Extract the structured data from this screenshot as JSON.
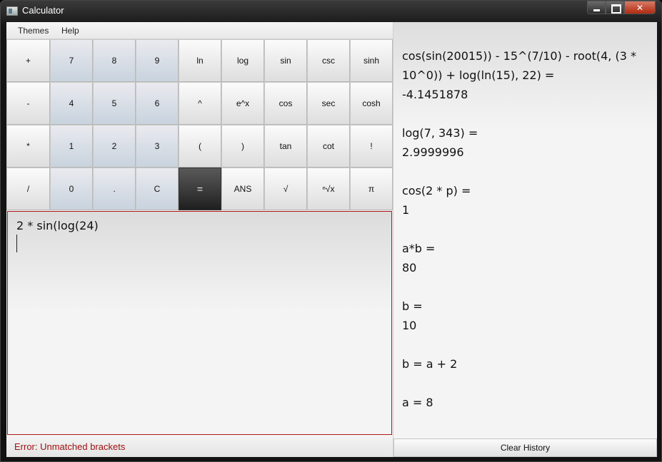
{
  "window": {
    "title": "Calculator"
  },
  "menu": {
    "themes": "Themes",
    "help": "Help"
  },
  "keypad": {
    "row1": [
      "+",
      "7",
      "8",
      "9",
      "ln",
      "log",
      "sin",
      "csc",
      "sinh"
    ],
    "row2": [
      "-",
      "4",
      "5",
      "6",
      "^",
      "e^x",
      "cos",
      "sec",
      "cosh"
    ],
    "row3": [
      "*",
      "1",
      "2",
      "3",
      "(",
      ")",
      "tan",
      "cot",
      "!"
    ],
    "row4": [
      "/",
      "0",
      ".",
      "C",
      "=",
      "ANS",
      "√",
      "ⁿ√x",
      "π"
    ]
  },
  "input": {
    "expression": "2 * sin(log(24)"
  },
  "status": {
    "error": "Error: Unmatched brackets"
  },
  "history": [
    {
      "lines": [
        "cos(sin(20015)) - 15^(7/10) - root(4, (3 *",
        "10^0)) + log(ln(15), 22) =",
        "-4.1451878"
      ]
    },
    {
      "lines": [
        "log(7, 343) =",
        "2.9999996"
      ]
    },
    {
      "lines": [
        "cos(2 * p) =",
        "1"
      ]
    },
    {
      "lines": [
        "a*b =",
        "80"
      ]
    },
    {
      "lines": [
        "b =",
        "10"
      ]
    },
    {
      "lines": [
        "b = a + 2"
      ]
    },
    {
      "lines": [
        "a = 8"
      ]
    }
  ],
  "clear_history_label": "Clear History",
  "colors": {
    "error": "#a01010",
    "input_border": "#b01818",
    "number_key": "#c8d3de"
  }
}
